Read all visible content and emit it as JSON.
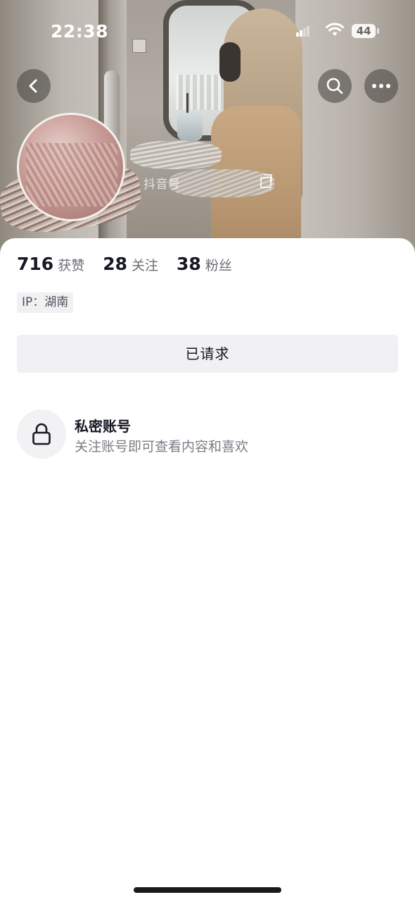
{
  "status_bar": {
    "time": "22:38",
    "battery": "44"
  },
  "header": {
    "douyin_id_label": "抖音号",
    "icons": [
      "back-arrow-icon",
      "search-icon",
      "more-icon",
      "copy-icon"
    ]
  },
  "stats": [
    {
      "num": "716",
      "label": "获赞"
    },
    {
      "num": "28",
      "label": "关注"
    },
    {
      "num": "38",
      "label": "粉丝"
    }
  ],
  "ip_tag": "IP：湖南",
  "request_button_label": "已请求",
  "private": {
    "title": "私密账号",
    "subtitle": "关注账号即可查看内容和喜欢",
    "icon": "lock-icon"
  }
}
